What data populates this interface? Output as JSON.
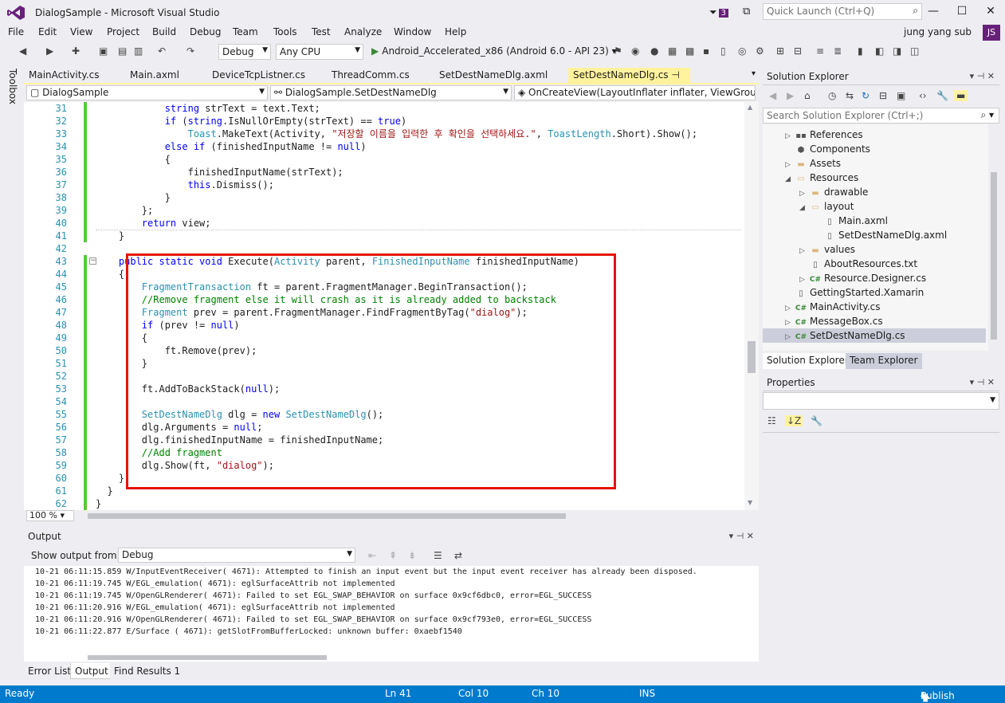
{
  "window": {
    "title": "DialogSample - Microsoft Visual Studio",
    "notification_count": "3",
    "quick_launch_placeholder": "Quick Launch (Ctrl+Q)",
    "user_name": "jung yang sub",
    "user_initials": "JS"
  },
  "menu": [
    "File",
    "Edit",
    "View",
    "Project",
    "Build",
    "Debug",
    "Team",
    "Tools",
    "Test",
    "Analyze",
    "Window",
    "Help"
  ],
  "toolbar": {
    "config": "Debug",
    "platform": "Any CPU",
    "run_target": "Android_Accelerated_x86 (Android 6.0 - API 23)"
  },
  "toolbox_label": "Toolbox",
  "doc_tabs": [
    "MainActivity.cs",
    "Main.axml",
    "DeviceTcpListner.cs",
    "ThreadComm.cs",
    "SetDestNameDlg.axml",
    "SetDestNameDlg.cs"
  ],
  "active_tab_pin": "⊣ ×",
  "navbar": {
    "project": "DialogSample",
    "class": "DialogSample.SetDestNameDlg",
    "member": "OnCreateView(LayoutInflater inflater, ViewGroup c"
  },
  "code_lines": [
    {
      "n": "31",
      "tokens": [
        [
          "",
          "            "
        ],
        [
          "kw",
          "string"
        ],
        [
          "",
          " strText = text.Text;"
        ]
      ]
    },
    {
      "n": "32",
      "tokens": [
        [
          "",
          "            "
        ],
        [
          "kw",
          "if"
        ],
        [
          "",
          " ("
        ],
        [
          "kw",
          "string"
        ],
        [
          "",
          ".IsNullOrEmpty(strText) == "
        ],
        [
          "kw",
          "true"
        ],
        [
          "",
          ")"
        ]
      ]
    },
    {
      "n": "33",
      "tokens": [
        [
          "",
          "                "
        ],
        [
          "ty",
          "Toast"
        ],
        [
          "",
          ".MakeText(Activity, "
        ],
        [
          "str",
          "\"저장할 이름을 입력한 후 확인을 선택하세요.\""
        ],
        [
          "",
          ", "
        ],
        [
          "ty",
          "ToastLength"
        ],
        [
          "",
          ".Short).Show();"
        ]
      ]
    },
    {
      "n": "34",
      "tokens": [
        [
          "",
          "            "
        ],
        [
          "kw",
          "else if"
        ],
        [
          "",
          " (finishedInputName != "
        ],
        [
          "kw",
          "null"
        ],
        [
          "",
          ")"
        ]
      ]
    },
    {
      "n": "35",
      "tokens": [
        [
          "",
          "            {"
        ]
      ]
    },
    {
      "n": "36",
      "tokens": [
        [
          "",
          "                finishedInputName(strText);"
        ]
      ]
    },
    {
      "n": "37",
      "tokens": [
        [
          "",
          "                "
        ],
        [
          "kw",
          "this"
        ],
        [
          "",
          ".Dismiss();"
        ]
      ]
    },
    {
      "n": "38",
      "tokens": [
        [
          "",
          "            }"
        ]
      ]
    },
    {
      "n": "39",
      "tokens": [
        [
          "",
          "        };"
        ]
      ]
    },
    {
      "n": "40",
      "tokens": [
        [
          "",
          "        "
        ],
        [
          "kw",
          "return"
        ],
        [
          "",
          " view;"
        ]
      ]
    },
    {
      "n": "41",
      "tokens": [
        [
          "",
          "    }"
        ]
      ]
    },
    {
      "n": "42",
      "tokens": [
        [
          "",
          ""
        ]
      ]
    },
    {
      "n": "43",
      "tokens": [
        [
          "",
          "    "
        ],
        [
          "kw",
          "public static void"
        ],
        [
          "",
          " Execute("
        ],
        [
          "ty",
          "Activity"
        ],
        [
          "",
          " parent, "
        ],
        [
          "ty",
          "FinishedInputName"
        ],
        [
          "",
          " finishedInputName)"
        ]
      ]
    },
    {
      "n": "44",
      "tokens": [
        [
          "",
          "    {"
        ]
      ]
    },
    {
      "n": "45",
      "tokens": [
        [
          "",
          "        "
        ],
        [
          "ty",
          "FragmentTransaction"
        ],
        [
          "",
          " ft = parent.FragmentManager.BeginTransaction();"
        ]
      ]
    },
    {
      "n": "46",
      "tokens": [
        [
          "",
          "        "
        ],
        [
          "cm",
          "//Remove fragment else it will crash as it is already added to backstack"
        ]
      ]
    },
    {
      "n": "47",
      "tokens": [
        [
          "",
          "        "
        ],
        [
          "ty",
          "Fragment"
        ],
        [
          "",
          " prev = parent.FragmentManager.FindFragmentByTag("
        ],
        [
          "str",
          "\"dialog\""
        ],
        [
          "",
          ");"
        ]
      ]
    },
    {
      "n": "48",
      "tokens": [
        [
          "",
          "        "
        ],
        [
          "kw",
          "if"
        ],
        [
          "",
          " (prev != "
        ],
        [
          "kw",
          "null"
        ],
        [
          "",
          ")"
        ]
      ]
    },
    {
      "n": "49",
      "tokens": [
        [
          "",
          "        {"
        ]
      ]
    },
    {
      "n": "50",
      "tokens": [
        [
          "",
          "            ft.Remove(prev);"
        ]
      ]
    },
    {
      "n": "51",
      "tokens": [
        [
          "",
          "        }"
        ]
      ]
    },
    {
      "n": "52",
      "tokens": [
        [
          "",
          ""
        ]
      ]
    },
    {
      "n": "53",
      "tokens": [
        [
          "",
          "        ft.AddToBackStack("
        ],
        [
          "kw",
          "null"
        ],
        [
          "",
          ");"
        ]
      ]
    },
    {
      "n": "54",
      "tokens": [
        [
          "",
          ""
        ]
      ]
    },
    {
      "n": "55",
      "tokens": [
        [
          "",
          "        "
        ],
        [
          "ty",
          "SetDestNameDlg"
        ],
        [
          "",
          " dlg = "
        ],
        [
          "kw",
          "new"
        ],
        [
          "",
          " "
        ],
        [
          "ty",
          "SetDestNameDlg"
        ],
        [
          "",
          "();"
        ]
      ]
    },
    {
      "n": "56",
      "tokens": [
        [
          "",
          "        dlg.Arguments = "
        ],
        [
          "kw",
          "null"
        ],
        [
          "",
          ";"
        ]
      ]
    },
    {
      "n": "57",
      "tokens": [
        [
          "",
          "        dlg.finishedInputName = finishedInputName;"
        ]
      ]
    },
    {
      "n": "58",
      "tokens": [
        [
          "",
          "        "
        ],
        [
          "cm",
          "//Add fragment"
        ]
      ]
    },
    {
      "n": "59",
      "tokens": [
        [
          "",
          "        dlg.Show(ft, "
        ],
        [
          "str",
          "\"dialog\""
        ],
        [
          "",
          ");"
        ]
      ]
    },
    {
      "n": "60",
      "tokens": [
        [
          "",
          "    }"
        ]
      ]
    },
    {
      "n": "61",
      "tokens": [
        [
          "",
          "  }"
        ]
      ]
    },
    {
      "n": "62",
      "tokens": [
        [
          "",
          "}"
        ]
      ]
    }
  ],
  "zoom": "100 %",
  "output": {
    "title": "Output",
    "show_from_label": "Show output from:",
    "source": "Debug",
    "lines": [
      "10-21 06:11:15.859 W/InputEventReceiver( 4671): Attempted to finish an input event but the input event receiver has already been disposed.",
      "10-21 06:11:19.745 W/EGL_emulation( 4671): eglSurfaceAttrib not implemented",
      "10-21 06:11:19.745 W/OpenGLRenderer( 4671): Failed to set EGL_SWAP_BEHAVIOR on surface 0x9cf6dbc0, error=EGL_SUCCESS",
      "10-21 06:11:20.916 W/EGL_emulation( 4671): eglSurfaceAttrib not implemented",
      "10-21 06:11:20.916 W/OpenGLRenderer( 4671): Failed to set EGL_SWAP_BEHAVIOR on surface 0x9cf793e0, error=EGL_SUCCESS",
      "10-21 06:11:22.877 E/Surface ( 4671): getSlotFromBufferLocked: unknown buffer: 0xaebf1540"
    ]
  },
  "bottom_tabs": [
    "Error List",
    "Output",
    "Find Results 1"
  ],
  "solution_explorer": {
    "title": "Solution Explorer",
    "search_placeholder": "Search Solution Explorer (Ctrl+;)",
    "items": [
      {
        "label": "References",
        "icon": "references-icon",
        "expander": "▷",
        "indent": 0
      },
      {
        "label": "Components",
        "icon": "components-icon",
        "expander": "",
        "indent": 0
      },
      {
        "label": "Assets",
        "icon": "folder-icon",
        "expander": "▷",
        "indent": 0
      },
      {
        "label": "Resources",
        "icon": "folder-open-icon",
        "expander": "◢",
        "indent": 0
      },
      {
        "label": "drawable",
        "icon": "folder-icon",
        "expander": "▷",
        "indent": 1
      },
      {
        "label": "layout",
        "icon": "folder-open-icon",
        "expander": "◢",
        "indent": 1
      },
      {
        "label": "Main.axml",
        "icon": "file-icon",
        "expander": "",
        "indent": 2
      },
      {
        "label": "SetDestNameDlg.axml",
        "icon": "file-icon",
        "expander": "",
        "indent": 2
      },
      {
        "label": "values",
        "icon": "folder-icon",
        "expander": "▷",
        "indent": 1
      },
      {
        "label": "AboutResources.txt",
        "icon": "file-icon",
        "expander": "",
        "indent": 1
      },
      {
        "label": "Resource.Designer.cs",
        "icon": "csharp-icon",
        "expander": "▷",
        "indent": 1
      },
      {
        "label": "GettingStarted.Xamarin",
        "icon": "file-icon",
        "expander": "",
        "indent": 0
      },
      {
        "label": "MainActivity.cs",
        "icon": "csharp-icon",
        "expander": "▷",
        "indent": 0
      },
      {
        "label": "MessageBox.cs",
        "icon": "csharp-icon",
        "expander": "▷",
        "indent": 0
      },
      {
        "label": "SetDestNameDlg.cs",
        "icon": "csharp-icon",
        "expander": "▷",
        "indent": 0,
        "selected": true
      }
    ],
    "tabs": [
      "Solution Explorer",
      "Team Explorer"
    ]
  },
  "properties": {
    "title": "Properties"
  },
  "status": {
    "ready": "Ready",
    "ln": "Ln 41",
    "col": "Col 10",
    "ch": "Ch 10",
    "mode": "INS",
    "publish": "Publish"
  },
  "colors": {
    "accent": "#007acc",
    "brand": "#68217a",
    "active_tab": "#fff29d",
    "highlight_box": "#e51400"
  }
}
